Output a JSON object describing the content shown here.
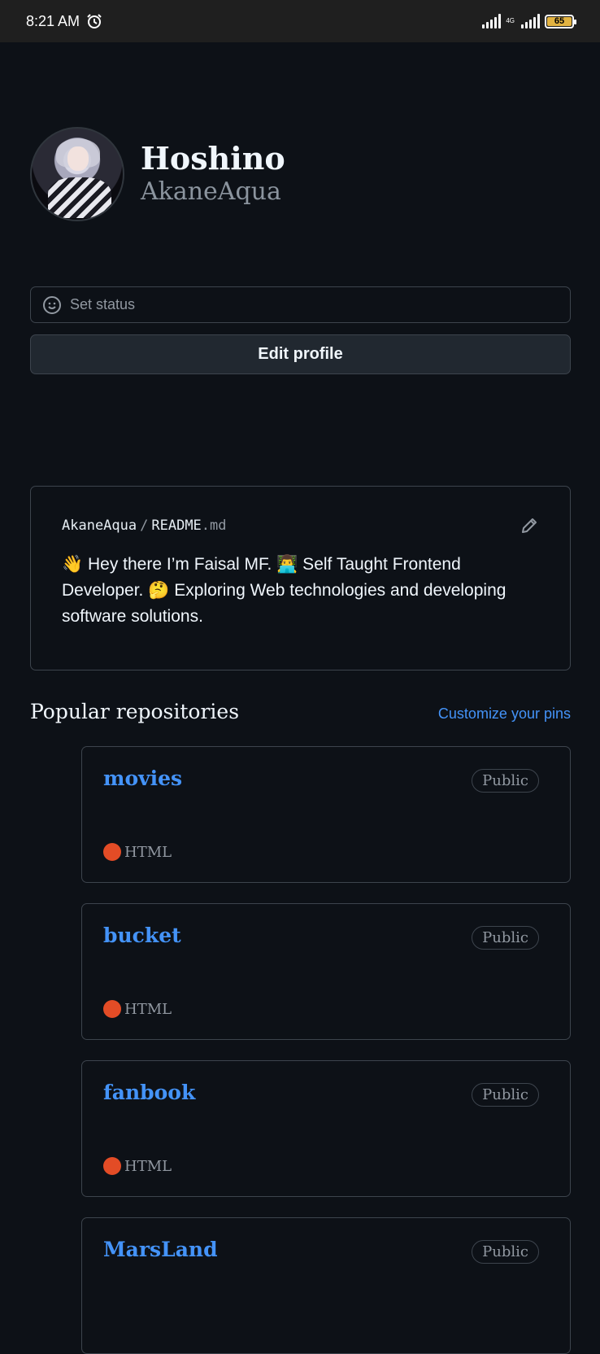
{
  "status_bar": {
    "time": "8:21 AM",
    "network_type": "4G",
    "battery": "65"
  },
  "profile": {
    "display_name": "Hoshino",
    "username": "AkaneAqua"
  },
  "actions": {
    "set_status": "Set status",
    "edit_profile": "Edit profile"
  },
  "readme": {
    "owner": "AkaneAqua",
    "separator": "/",
    "file_base": "README",
    "file_ext": ".md",
    "body": "👋 Hey there I’m Faisal MF. 👨‍💻 Self Taught Frontend Developer. 🤔 Exploring Web technologies and developing software solutions."
  },
  "popular": {
    "title": "Popular repositories",
    "customize_link": "Customize your pins",
    "repos": [
      {
        "name": "movies",
        "visibility": "Public",
        "language": "HTML",
        "language_color": "#e34c26"
      },
      {
        "name": "bucket",
        "visibility": "Public",
        "language": "HTML",
        "language_color": "#e34c26"
      },
      {
        "name": "fanbook",
        "visibility": "Public",
        "language": "HTML",
        "language_color": "#e34c26"
      },
      {
        "name": "MarsLand",
        "visibility": "Public",
        "language": "",
        "language_color": "#e34c26"
      }
    ]
  },
  "colors": {
    "background": "#0d1117",
    "link": "#4493f8",
    "border": "#3d444d",
    "muted": "#9198a1"
  }
}
